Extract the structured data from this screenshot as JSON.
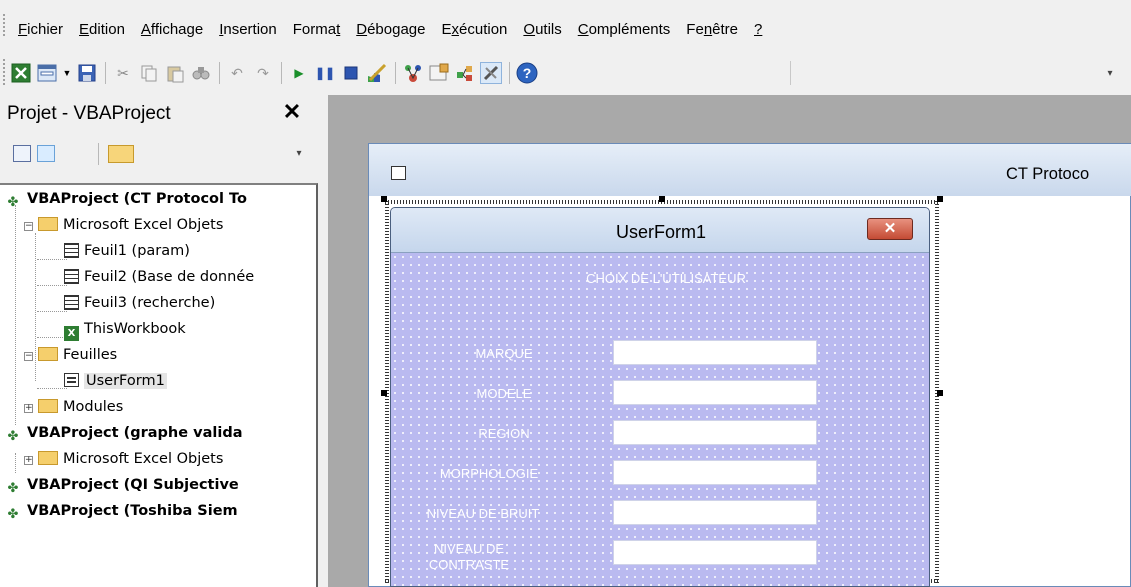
{
  "menu": {
    "items": [
      {
        "pre": "",
        "u": "F",
        "post": "ichier"
      },
      {
        "pre": "",
        "u": "E",
        "post": "dition"
      },
      {
        "pre": "",
        "u": "A",
        "post": "ffichage"
      },
      {
        "pre": "",
        "u": "I",
        "post": "nsertion"
      },
      {
        "pre": "Forma",
        "u": "t",
        "post": ""
      },
      {
        "pre": "",
        "u": "D",
        "post": "ébogage"
      },
      {
        "pre": "E",
        "u": "x",
        "post": "écution"
      },
      {
        "pre": "",
        "u": "O",
        "post": "utils"
      },
      {
        "pre": "",
        "u": "C",
        "post": "ompléments"
      },
      {
        "pre": "Fe",
        "u": "n",
        "post": "être"
      },
      {
        "pre": "",
        "u": "?",
        "post": ""
      }
    ]
  },
  "toolbar": {
    "icons": [
      "excel-view-icon",
      "insert-userform-icon",
      "save-icon",
      "cut-icon",
      "copy-icon",
      "paste-icon",
      "find-icon",
      "undo-icon",
      "redo-icon",
      "run-icon",
      "break-icon",
      "reset-icon",
      "design-mode-icon",
      "project-explorer-icon",
      "properties-icon",
      "object-browser-icon",
      "toolbox-icon",
      "help-icon"
    ]
  },
  "project": {
    "title": "Projet - VBAProject",
    "close": "✕",
    "tree": {
      "p1": "VBAProject (CT Protocol To",
      "excel_objects": "Microsoft Excel Objets",
      "feuil1": "Feuil1 (param)",
      "feuil2": "Feuil2 (Base de donnée",
      "feuil3": "Feuil3 (recherche)",
      "thisworkbook": "ThisWorkbook",
      "feuilles": "Feuilles",
      "userform1": "UserForm1",
      "modules": "Modules",
      "p2": "VBAProject (graphe valida",
      "p2_excel_objects": "Microsoft Excel Objets",
      "p3": "VBAProject (QI Subjective",
      "p4": "VBAProject (Toshiba Siem"
    }
  },
  "document": {
    "title": "CT Protoco"
  },
  "userform": {
    "title": "UserForm1",
    "close": "✕",
    "heading": "CHOIX DE L'UTILISATEUR",
    "fields": [
      {
        "label": "MARQUE"
      },
      {
        "label": "MODELE"
      },
      {
        "label": "REGION"
      },
      {
        "label": "MORPHOLOGIE"
      },
      {
        "label": "NIVEAU DE BRUIT"
      },
      {
        "label": "NIVEAU DE CONTRASTE"
      }
    ]
  }
}
